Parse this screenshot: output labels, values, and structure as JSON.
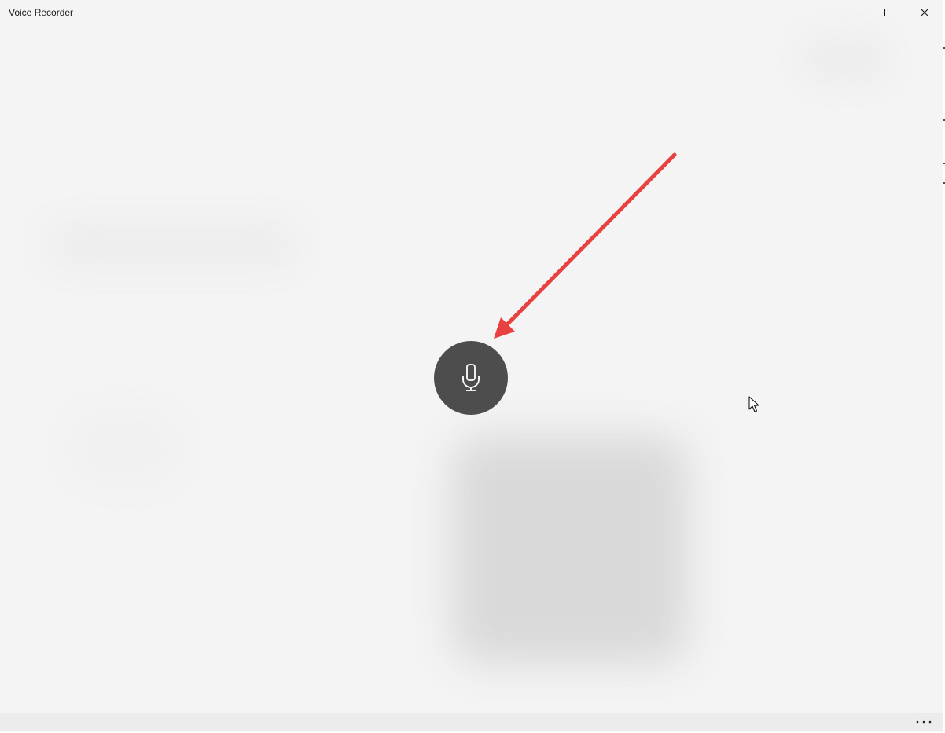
{
  "window": {
    "title": "Voice Recorder"
  },
  "caption_buttons": {
    "minimize_icon": "minimize-icon",
    "maximize_icon": "maximize-icon",
    "close_icon": "close-icon"
  },
  "main": {
    "record_button_icon": "microphone-icon",
    "annotation_arrow_color": "#e8413f",
    "record_button_color": "#4d4d4d"
  },
  "bottom_bar": {
    "more_label": "..."
  }
}
